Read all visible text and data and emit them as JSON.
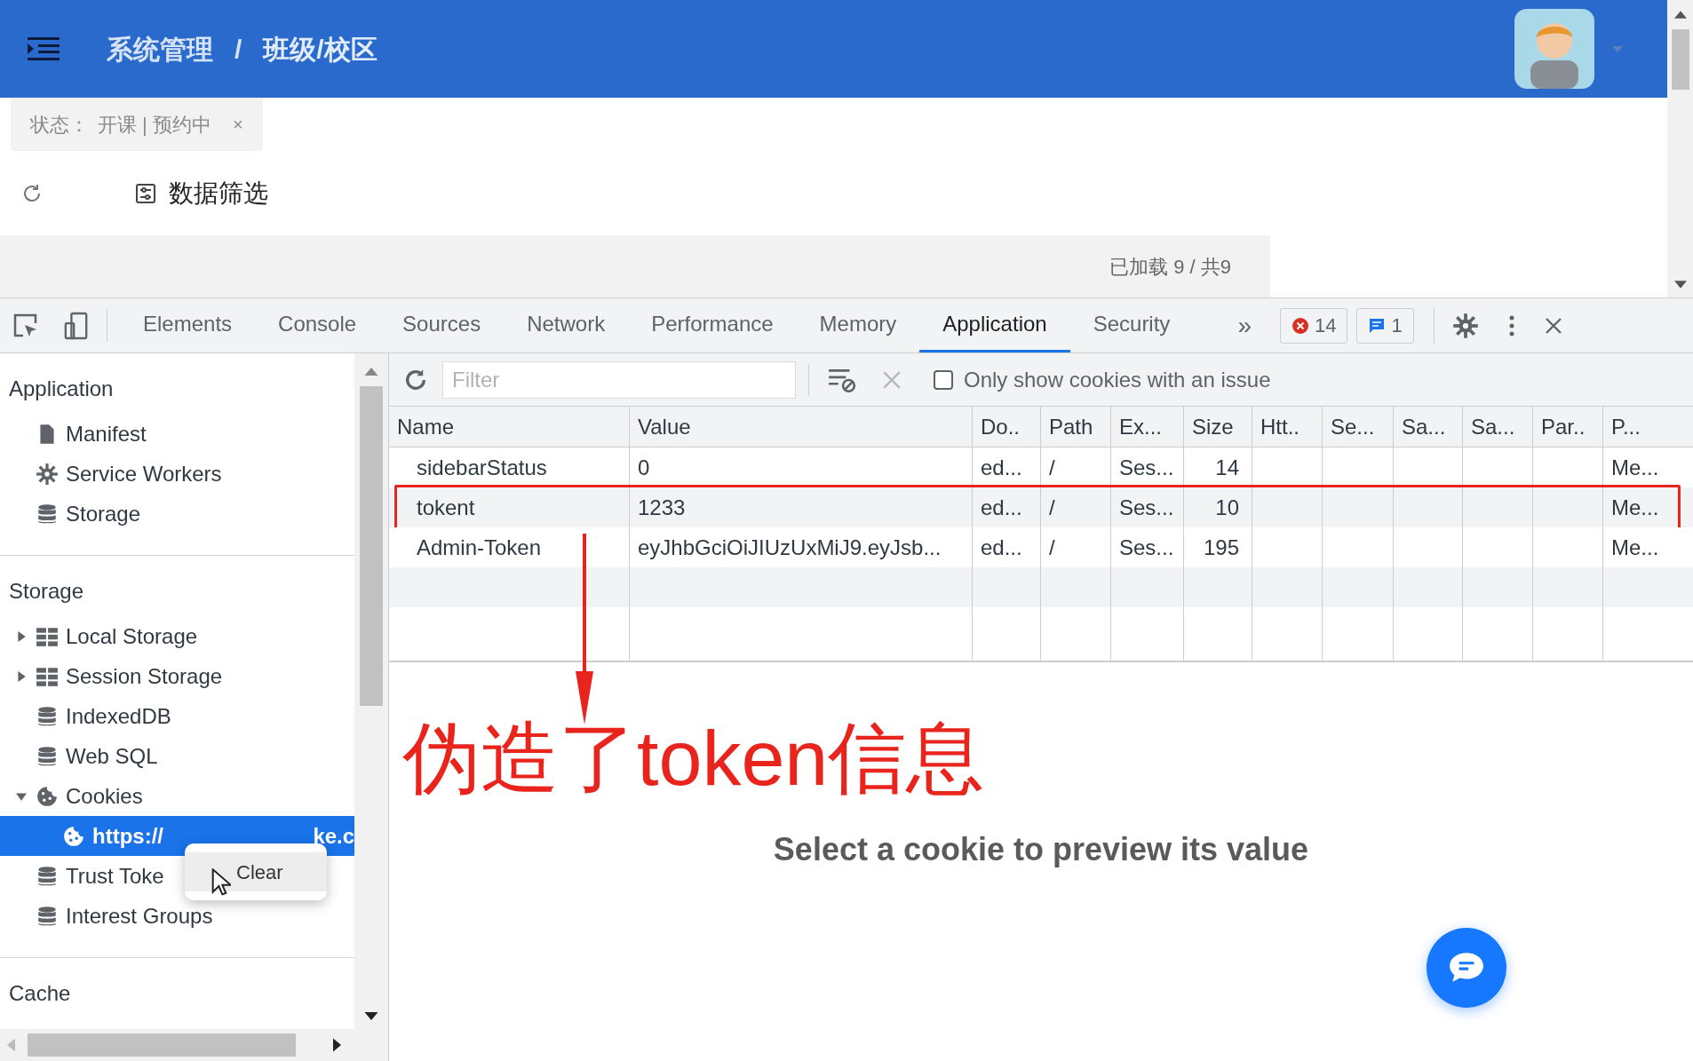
{
  "header": {
    "breadcrumb": [
      "系统管理",
      "班级/校区"
    ],
    "separator": "/"
  },
  "filter_tag": {
    "label": "状态：",
    "value": "开课 | 预约中",
    "close": "×"
  },
  "toolbar": {
    "filter_button": "数据筛选"
  },
  "loaded_text": "已加载 9 / 共9",
  "devtools": {
    "tabs": [
      {
        "label": "Elements",
        "selected": false
      },
      {
        "label": "Console",
        "selected": false
      },
      {
        "label": "Sources",
        "selected": false
      },
      {
        "label": "Network",
        "selected": false
      },
      {
        "label": "Performance",
        "selected": false
      },
      {
        "label": "Memory",
        "selected": false
      },
      {
        "label": "Application",
        "selected": true
      },
      {
        "label": "Security",
        "selected": false
      }
    ],
    "overflow": "»",
    "errors": "14",
    "messages": "1"
  },
  "sidebar": {
    "sections": [
      {
        "title": "Application",
        "items": [
          {
            "label": "Manifest",
            "kind": "document",
            "selected": false
          },
          {
            "label": "Service Workers",
            "kind": "gear",
            "selected": false
          },
          {
            "label": "Storage",
            "kind": "database",
            "selected": false
          }
        ]
      },
      {
        "title": "Storage",
        "items": [
          {
            "label": "Local Storage",
            "kind": "grid",
            "selected": false,
            "expanded": false
          },
          {
            "label": "Session Storage",
            "kind": "grid",
            "selected": false,
            "expanded": false
          },
          {
            "label": "IndexedDB",
            "kind": "database",
            "selected": false
          },
          {
            "label": "Web SQL",
            "kind": "database",
            "selected": false
          },
          {
            "label": "Cookies",
            "kind": "cookie",
            "selected": false,
            "expanded": true,
            "children": [
              {
                "label": "https://",
                "tail": "ke.c",
                "kind": "cookie",
                "selected": true
              }
            ]
          },
          {
            "label": "Trust Toke",
            "kind": "database",
            "selected": false
          },
          {
            "label": "Interest Groups",
            "kind": "database",
            "selected": false
          }
        ]
      },
      {
        "title": "Cache"
      }
    ]
  },
  "context_menu": {
    "items": [
      {
        "label": "Clear"
      }
    ]
  },
  "cookies": {
    "filter": {
      "placeholder": "Filter"
    },
    "issue_checkbox": {
      "label": "Only show cookies with an issue",
      "checked": false
    },
    "columns": [
      "Name",
      "Value",
      "Do..",
      "Path",
      "Ex...",
      "Size",
      "Htt..",
      "Se...",
      "Sa...",
      "Sa...",
      "Par..",
      "P..."
    ],
    "rows": [
      {
        "cells": [
          "sidebarStatus",
          "0",
          "ed...",
          "/",
          "Ses...",
          "14",
          "",
          "",
          "",
          "",
          "",
          "Me..."
        ],
        "marked": false
      },
      {
        "cells": [
          "tokent",
          "1233",
          "ed...",
          "/",
          "Ses...",
          "10",
          "",
          "",
          "",
          "",
          "",
          "Me..."
        ],
        "marked": true
      },
      {
        "cells": [
          "Admin-Token",
          "eyJhbGciOiJIUzUxMiJ9.eyJsb...",
          "ed...",
          "/",
          "Ses...",
          "195",
          "",
          "",
          "",
          "",
          "",
          "Me..."
        ],
        "marked": false
      }
    ],
    "preview_message": "Select a cookie to preview its value"
  },
  "annotation": {
    "text": "伪造了token信息"
  }
}
